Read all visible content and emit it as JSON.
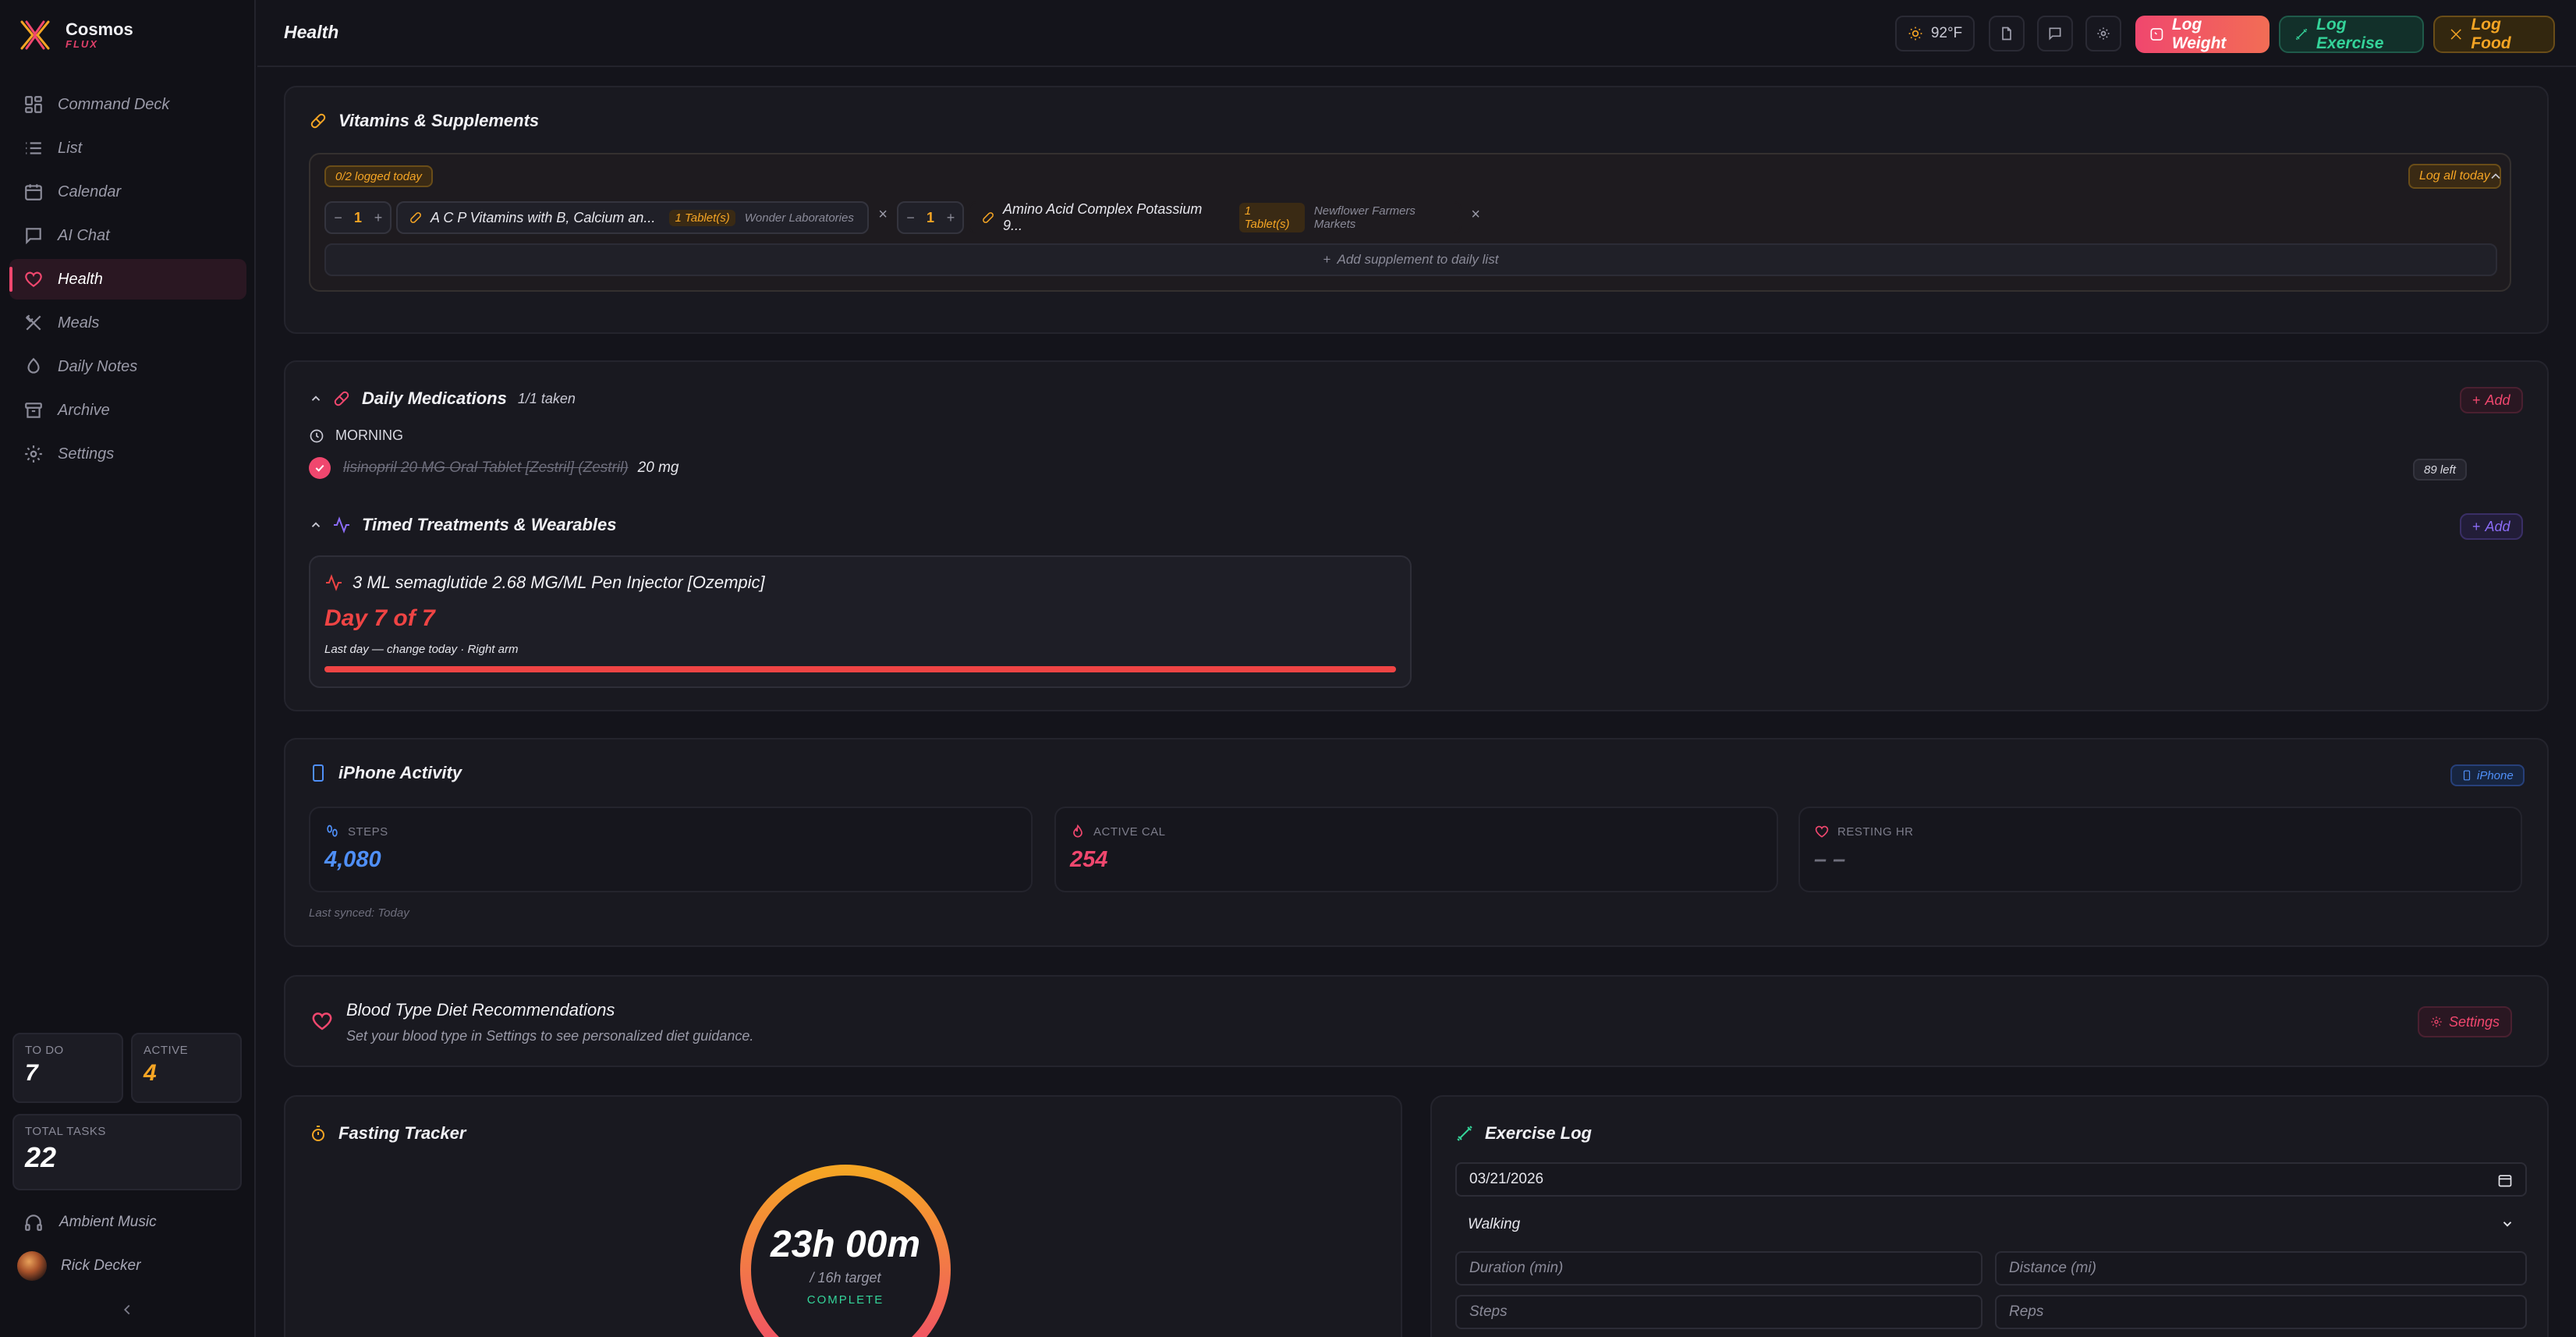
{
  "brand": {
    "name": "Cosmos",
    "sub": "FLUX"
  },
  "sidebar": {
    "items": [
      {
        "label": "Command Deck",
        "icon": "grid-icon"
      },
      {
        "label": "List",
        "icon": "list-icon"
      },
      {
        "label": "Calendar",
        "icon": "calendar-icon"
      },
      {
        "label": "AI Chat",
        "icon": "chat-icon"
      },
      {
        "label": "Health",
        "icon": "heart-icon"
      },
      {
        "label": "Meals",
        "icon": "utensils-icon"
      },
      {
        "label": "Daily Notes",
        "icon": "note-icon"
      },
      {
        "label": "Archive",
        "icon": "archive-icon"
      },
      {
        "label": "Settings",
        "icon": "gear-icon"
      }
    ],
    "active": "Health",
    "stats": {
      "todo_label": "TO DO",
      "todo_value": "7",
      "active_label": "ACTIVE",
      "active_value": "4",
      "total_label": "TOTAL TASKS",
      "total_value": "22"
    },
    "ambient": "Ambient Music",
    "user": "Rick Decker"
  },
  "topbar": {
    "title": "Health",
    "weather": "92°F",
    "log_weight": "Log Weight",
    "log_exercise": "Log Exercise",
    "log_food": "Log Food"
  },
  "vitamins": {
    "title": "Vitamins & Supplements",
    "logged": "0/2 logged today",
    "log_all": "Log all today",
    "items": [
      {
        "qty": "1",
        "name": "A C P Vitamins with B, Calcium an...",
        "dose": "1 Tablet(s)",
        "maker": "Wonder Laboratories"
      },
      {
        "qty": "1",
        "name": "Amino Acid Complex Potassium 9...",
        "dose": "1 Tablet(s)",
        "maker": "Newflower Farmers Markets"
      }
    ],
    "add": "Add supplement to daily list"
  },
  "medications": {
    "title": "Daily Medications",
    "taken": "1/1 taken",
    "add": "Add",
    "period": "MORNING",
    "med_name": "lisinopril 20 MG Oral Tablet [Zestril] (Zestril)",
    "med_dose": "20 mg",
    "left": "89 left"
  },
  "treatments": {
    "title": "Timed Treatments & Wearables",
    "add": "Add",
    "item_name": "3 ML semaglutide 2.68 MG/ML Pen Injector [Ozempic]",
    "day": "Day 7 of 7",
    "note": "Last day — change today · Right arm",
    "progress": 1.0
  },
  "iphone": {
    "title": "iPhone Activity",
    "badge": "iPhone",
    "steps_label": "STEPS",
    "steps": "4,080",
    "cal_label": "ACTIVE CAL",
    "cal": "254",
    "hr_label": "RESTING HR",
    "hr": "– –",
    "synced": "Last synced: Today"
  },
  "bloodtype": {
    "title": "Blood Type Diet Recommendations",
    "sub": "Set your blood type in Settings to see personalized diet guidance.",
    "settings": "Settings"
  },
  "fasting": {
    "title": "Fasting Tracker",
    "time": "23h 00m",
    "target": "/ 16h target",
    "status": "COMPLETE"
  },
  "exercise": {
    "title": "Exercise Log",
    "date": "03/21/2026",
    "type": "Walking",
    "duration_ph": "Duration (min)",
    "distance_ph": "Distance (mi)",
    "steps_ph": "Steps",
    "reps_ph": "Reps"
  },
  "colors": {
    "accent_pink": "#f0476e",
    "accent_green": "#34d399",
    "accent_amber": "#f5a524",
    "accent_blue": "#4f8ff7"
  }
}
